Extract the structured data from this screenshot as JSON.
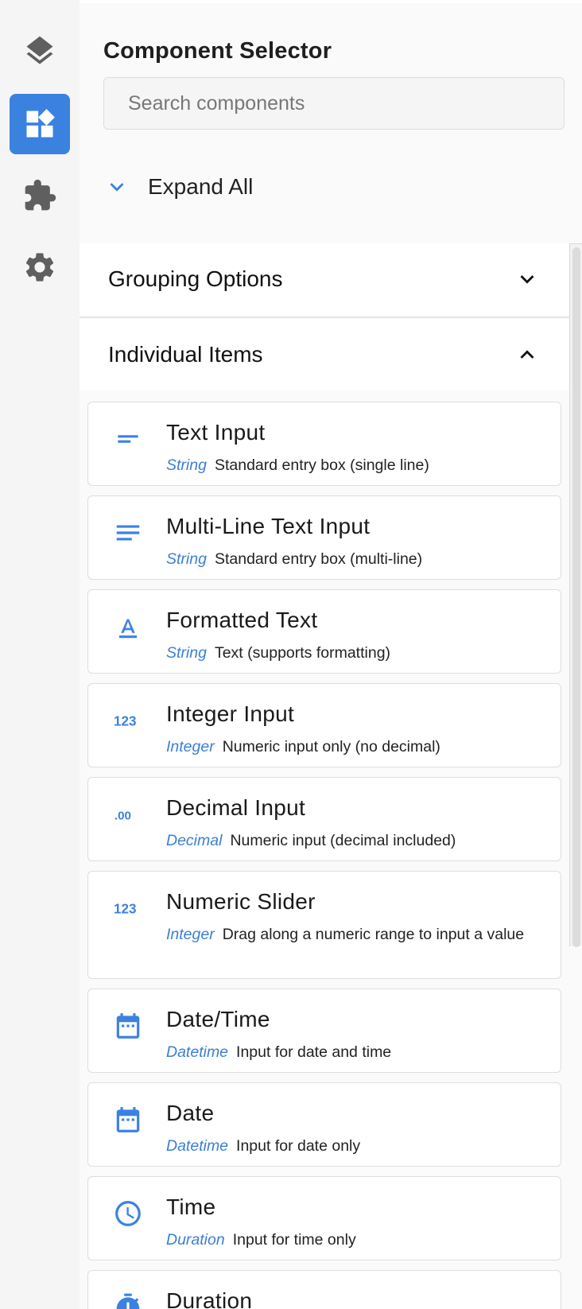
{
  "panel": {
    "title": "Component Selector",
    "search_placeholder": "Search components",
    "expand_all_label": "Expand All"
  },
  "rail": {
    "items": [
      {
        "icon": "layers-icon",
        "active": false
      },
      {
        "icon": "widgets-icon",
        "active": true
      },
      {
        "icon": "puzzle-icon",
        "active": false
      },
      {
        "icon": "gear-icon",
        "active": false
      }
    ]
  },
  "sections": {
    "grouping": {
      "label": "Grouping Options",
      "state": "collapsed"
    },
    "individual": {
      "label": "Individual Items",
      "state": "expanded"
    }
  },
  "items": [
    {
      "name": "Text Input",
      "type": "String",
      "description": "Standard entry box (single line)",
      "icon": "short-text-icon"
    },
    {
      "name": "Multi-Line Text Input",
      "type": "String",
      "description": "Standard entry box (multi-line)",
      "icon": "notes-icon"
    },
    {
      "name": "Formatted Text",
      "type": "String",
      "description": "Text (supports formatting)",
      "icon": "text-format-icon"
    },
    {
      "name": "Integer Input",
      "type": "Integer",
      "description": "Numeric input only (no decimal)",
      "icon": "numbers-123-icon"
    },
    {
      "name": "Decimal Input",
      "type": "Decimal",
      "description": "Numeric input (decimal included)",
      "icon": "decimal-icon"
    },
    {
      "name": "Numeric Slider",
      "type": "Integer",
      "description": "Drag along a numeric range to input a value",
      "icon": "numbers-123-icon"
    },
    {
      "name": "Date/Time",
      "type": "Datetime",
      "description": "Input for date and time",
      "icon": "calendar-icon"
    },
    {
      "name": "Date",
      "type": "Datetime",
      "description": "Input for date only",
      "icon": "calendar-icon"
    },
    {
      "name": "Time",
      "type": "Duration",
      "description": "Input for time only",
      "icon": "clock-icon"
    },
    {
      "name": "Duration",
      "type": "",
      "description": "",
      "icon": "timer-icon"
    }
  ],
  "colors": {
    "accent": "#3b82e0",
    "type_text": "#3b7fd4",
    "icon_gray": "#616161"
  }
}
